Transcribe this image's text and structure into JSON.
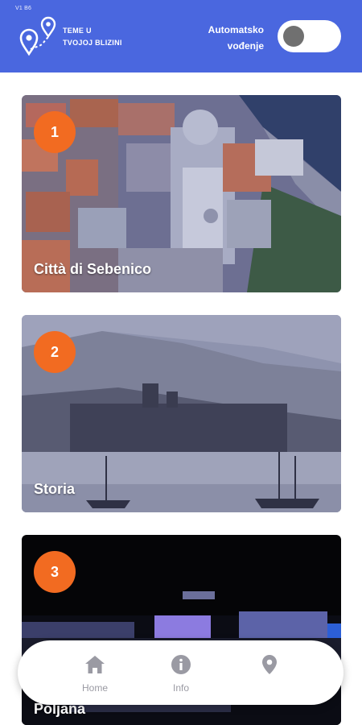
{
  "header": {
    "version": "V1 B6",
    "title_line1": "TEME U",
    "title_line2": "TVOJOJ BLIZINI",
    "auto_line1": "Automatsko",
    "auto_line2": "vođenje",
    "auto_guide_on": false,
    "icon": "location-pins-icon"
  },
  "cards": [
    {
      "number": "1",
      "title": "Città di Sebenico"
    },
    {
      "number": "2",
      "title": "Storia"
    },
    {
      "number": "3",
      "title": "Poljana"
    }
  ],
  "nav": {
    "items": [
      {
        "label": "Home",
        "icon": "home-icon"
      },
      {
        "label": "Info",
        "icon": "info-icon"
      },
      {
        "label": "",
        "icon": "map-pin-icon"
      }
    ]
  },
  "colors": {
    "header_bg": "#4a67df",
    "badge": "#f26b21",
    "nav_inactive": "#9a9aa3"
  }
}
